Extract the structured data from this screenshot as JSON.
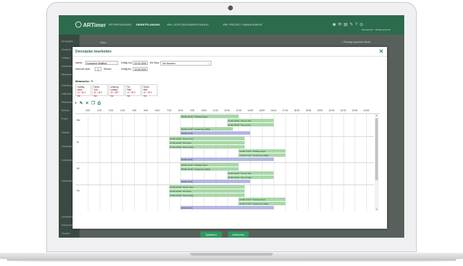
{
  "app": {
    "logo": "ARTimer",
    "nav_tabs": [
      {
        "label": "ZEITERFASSUNG",
        "active": false
      },
      {
        "label": "DIENSTPLANUNG",
        "active": true
      },
      {
        "label": "BRL LEISTUNGSABRECHNUNG",
        "active": false
      },
      {
        "label": "BRL PROJECT MANAGEMENT",
        "active": false
      }
    ],
    "top_icons": [
      "globe-icon",
      "mail-icon",
      "chart-icon",
      "chat-icon",
      "tools-icon",
      "help-icon",
      "user-icon"
    ],
    "user_info": "Administrator · Beratung GmbH",
    "background_filter": "Filter",
    "background_right": "1 Einträge gesichtet   Heute",
    "sidebar_items": [
      "Dienstpläne",
      "Übersicht",
      "Vorlagen",
      "Auswertungen",
      "Mitarbeiter",
      "Einstellungen",
      "Zeitkonten",
      "Abwesenheiten",
      "Berichte",
      "Export",
      "Statistik",
      "Urlaubsplanung",
      "Schichtplanung",
      "Stammdaten",
      "Dienststellen",
      "Dokumente und Dateien",
      "Gesperrt"
    ]
  },
  "dialog": {
    "title": "Dienstplan bearbeiten",
    "close_icon": "close-icon",
    "fields": {
      "name_label": "Name:",
      "name_value": "Konsolent Teilöffice",
      "gueltig_von_label": "Gültig von",
      "gueltig_von_value": "22.02.2025",
      "einheit_label": "EinTsea",
      "einheit_value": "Std Standen",
      "intervall_label": "Intervall: jede",
      "intervall_value": "2",
      "intervall_unit": "Woche",
      "gueltig_bis_label": "Gültig bis",
      "gueltig_bis_value": "15.08.2025"
    },
    "mitarbeiter_label": "Mitarbeiter",
    "employees": [
      {
        "first": "Holiday",
        "last": "Hans",
        "hours": "15 / 38.5 Std"
      },
      {
        "first": "Demo",
        "last": "Tom",
        "hours": "35 / 38.5 Std"
      },
      {
        "first": "Leistung",
        "last": "Ludwig",
        "hours": "15 / 38.5 Std"
      },
      {
        "first": "Pio",
        "last": "Paul",
        "hours": "13 / 38.5 Std"
      },
      {
        "first": "Demo",
        "last": "Max",
        "hours": "30 / 38.5 Std"
      }
    ],
    "toolbar_icons": [
      "add-icon",
      "edit-icon",
      "delete-icon",
      "copy-icon",
      "print-icon"
    ],
    "hours": [
      "0:00",
      "1:00",
      "2:00",
      "3:00",
      "4:00",
      "5:00",
      "6:00",
      "7:00",
      "8:00",
      "9:00",
      "10:00",
      "11:00",
      "12:00",
      "13:00",
      "14:00",
      "15:00",
      "16:00",
      "17:00",
      "18:00",
      "19:00",
      "20:00",
      "21:00",
      "22:00",
      "23:00",
      "24:00"
    ],
    "days": [
      {
        "label": "Mo",
        "rows": 5,
        "shifts": [
          {
            "start": 8,
            "end": 13,
            "text": "08:00-12:30 * Holiday Hans",
            "color": "green"
          },
          {
            "start": 12,
            "end": 16,
            "text": "12:00-16:00 * Demo Tom",
            "color": "green"
          },
          {
            "start": 12,
            "end": 16,
            "text": "12:00-16:00 * Demo Pio",
            "color": "green"
          },
          {
            "start": 8,
            "end": 12.5,
            "text": "08:00-12:30 * Leistung Ludwig",
            "color": "green"
          },
          {
            "start": 8,
            "end": 14,
            "text": "08:00-15:30",
            "color": "purple"
          }
        ]
      },
      {
        "label": "Di",
        "rows": 6,
        "shifts": [
          {
            "start": 7,
            "end": 13.5,
            "text": "07:00-13:00 * Demo Tom",
            "color": "green"
          },
          {
            "start": 7,
            "end": 13.5,
            "text": "07:00-13:00 * Pio Paul",
            "color": "green"
          },
          {
            "start": 7,
            "end": 13.5,
            "text": "07:00-13:00 * Demo Max",
            "color": "green"
          },
          {
            "start": 13,
            "end": 17,
            "text": "13:00-17:00 * Holiday Hans",
            "color": "green"
          },
          {
            "start": 13,
            "end": 17,
            "text": "13:00-17:00 * Leistung Ludwig",
            "color": "green"
          },
          {
            "start": 8,
            "end": 16,
            "text": "08:00-18:00",
            "color": "purple"
          }
        ]
      },
      {
        "label": "Mi",
        "rows": 5,
        "shifts": [
          {
            "start": 8,
            "end": 13,
            "text": "08:00-12:30 * Holiday Hans",
            "color": "green"
          },
          {
            "start": 8,
            "end": 13,
            "text": "08:00-12:30 * Leistung Ludwig",
            "color": "green"
          },
          {
            "start": 12,
            "end": 16,
            "text": "12:00-16:00 * Demo Tom",
            "color": "green"
          },
          {
            "start": 12,
            "end": 16,
            "text": "12:00-16:00 * Demo Max",
            "color": "green"
          },
          {
            "start": 8,
            "end": 14,
            "text": "08:00-15:00",
            "color": "purple"
          }
        ]
      },
      {
        "label": "Do",
        "rows": 6,
        "shifts": [
          {
            "start": 7,
            "end": 13.5,
            "text": "07:00-13:00 * Demo Tom",
            "color": "green"
          },
          {
            "start": 7,
            "end": 13.5,
            "text": "07:00-13:00 * Pio Paul",
            "color": "green"
          },
          {
            "start": 7,
            "end": 13.5,
            "text": "07:00-13:00 * Demo Max",
            "color": "green"
          },
          {
            "start": 13,
            "end": 17,
            "text": "13:00-17:00 * Holiday Hans",
            "color": "green"
          },
          {
            "start": 13,
            "end": 17,
            "text": "13:00-17:00 * Leistung Ludwig",
            "color": "green"
          },
          {
            "start": 8,
            "end": 16,
            "text": "08:00-15:00",
            "color": "purple"
          }
        ]
      }
    ],
    "buttons": {
      "save": "Speichern",
      "cancel": "Abbrechen"
    },
    "colors": {
      "accent": "#2d9a5f",
      "shift_green": "#a9d8a9",
      "shift_purple": "#b4b6e4",
      "topbar": "#2d6b4d",
      "overtime": "#d42020"
    }
  }
}
